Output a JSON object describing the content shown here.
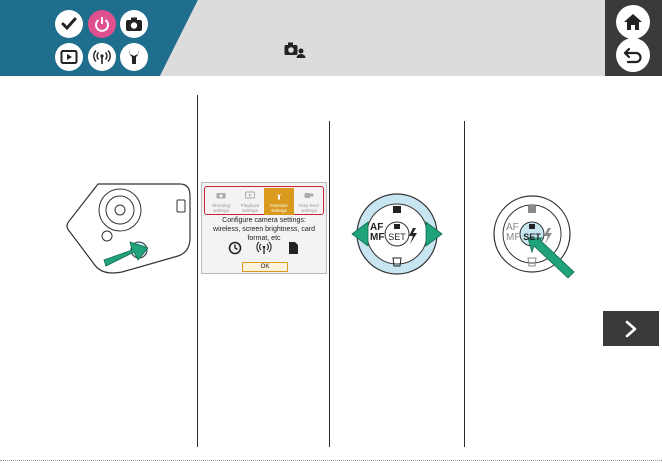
{
  "header": {
    "bg_color": "#1f6e8e",
    "accent_color": "#e05090",
    "mode_icons": [
      {
        "icon": "check-icon"
      },
      {
        "icon": "power-icon"
      },
      {
        "icon": "camera-icon"
      },
      {
        "icon": "playback-icon"
      },
      {
        "icon": "wireless-icon"
      },
      {
        "icon": "wrench-icon"
      }
    ],
    "section_icon": "camera-user-icon",
    "home_icon": "home-icon",
    "back_icon": "back-icon"
  },
  "screen": {
    "tabs": [
      {
        "label": "Shooting settings"
      },
      {
        "label": "Playback settings"
      },
      {
        "label": "Function settings"
      },
      {
        "label": "Disp level settings"
      }
    ],
    "description": "Configure camera settings: wireless, screen brightness, card format, etc",
    "ok_label": "OK",
    "icons": [
      "clock-icon",
      "wireless-icon",
      "card-icon"
    ]
  },
  "dial": {
    "left_label_top": "AF",
    "left_label_bottom": "MF",
    "center_label": "SET"
  },
  "next_icon": "chevron-right-icon"
}
